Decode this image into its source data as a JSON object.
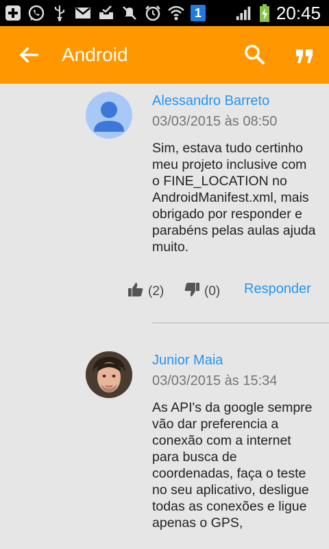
{
  "status_bar": {
    "time": "20:45",
    "icons": [
      "add-icon",
      "whatsapp-icon",
      "usb-icon",
      "gmail-icon",
      "inbox-icon",
      "mute-icon",
      "alarm-icon",
      "wifi-icon",
      "sim-1-icon",
      "signal-icon",
      "battery-charging-icon"
    ],
    "sim_label": "1"
  },
  "toolbar": {
    "title": "Android",
    "back_icon": "arrow-back-icon",
    "search_icon": "search-icon",
    "quote_icon": "quote-icon",
    "color": "#ff9800"
  },
  "comments": [
    {
      "author": "Alessandro Barreto",
      "date": "03/03/2015 às 08:50",
      "body": "Sim, estava tudo certinho meu projeto inclusive com o FINE_LOCATION no AndroidManifest.xml, mais obrigado por responder e parabéns pelas aulas ajuda muito.",
      "likes": "(2)",
      "dislikes": "(0)",
      "reply_label": "Responder",
      "avatar": "default-avatar"
    },
    {
      "author": "Junior Maia",
      "date": "03/03/2015 às 15:34",
      "body": "As API's da google sempre vão dar preferencia a conexão com a internet para busca de coordenadas, faça o teste no seu aplicativo, desligue todas as conexões e ligue apenas o GPS,",
      "avatar": "user-photo"
    }
  ],
  "colors": {
    "link": "#2196f3",
    "background": "#e6e6e6"
  }
}
